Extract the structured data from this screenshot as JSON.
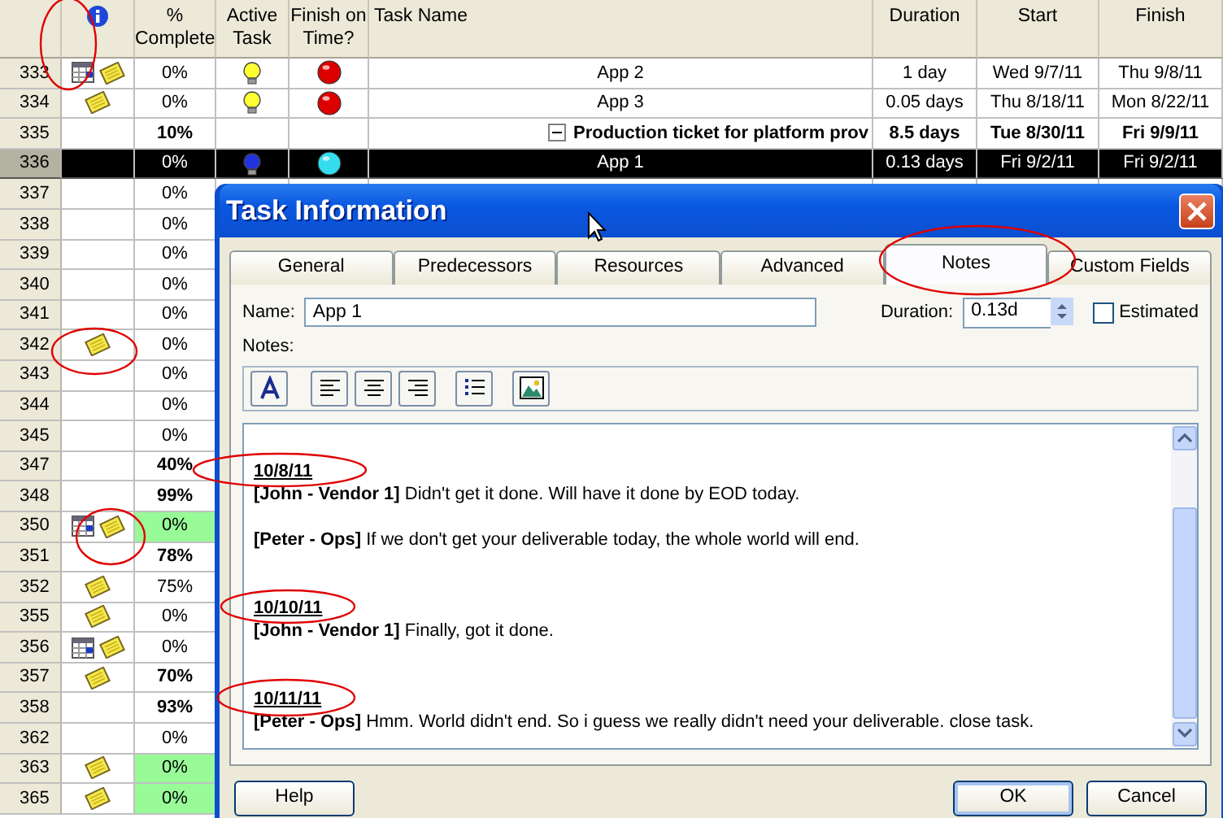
{
  "columns": [
    {
      "kind": "rowid"
    },
    {
      "kind": "indicators"
    },
    {
      "kind": "percent",
      "label": "% Complete"
    },
    {
      "kind": "active",
      "label": "Active Task"
    },
    {
      "kind": "ontime",
      "label": "Finish on Time?"
    },
    {
      "kind": "name",
      "label": "Task Name"
    },
    {
      "kind": "duration",
      "label": "Duration"
    },
    {
      "kind": "start",
      "label": "Start"
    },
    {
      "kind": "finish",
      "label": "Finish"
    }
  ],
  "rows": [
    {
      "id": "333",
      "indicators": [
        {
          "kind": "calendar"
        },
        {
          "kind": "note"
        }
      ],
      "percent": "0%",
      "summary": false,
      "highlight": false,
      "selected": false,
      "active": {
        "color": "#ffff33"
      },
      "on_time": {
        "color": "#dd0000"
      },
      "name": "App 2",
      "duration": "1 day",
      "start": "Wed 9/7/11",
      "finish": "Thu 9/8/11"
    },
    {
      "id": "334",
      "indicators": [
        {
          "kind": "note"
        }
      ],
      "percent": "0%",
      "summary": false,
      "highlight": false,
      "selected": false,
      "active": {
        "color": "#ffff33"
      },
      "on_time": {
        "color": "#dd0000"
      },
      "name": "App 3",
      "duration": "0.05 days",
      "start": "Thu 8/18/11",
      "finish": "Mon 8/22/11"
    },
    {
      "id": "335",
      "indicators": [],
      "percent": "10%",
      "summary": true,
      "expanded": true,
      "highlight": false,
      "selected": false,
      "name": "Production ticket for platform prov",
      "duration": "8.5 days",
      "start": "Tue 8/30/11",
      "finish": "Fri 9/9/11"
    },
    {
      "id": "336",
      "indicators": [],
      "percent": "0%",
      "summary": false,
      "highlight": false,
      "selected": true,
      "active": {
        "color": "#2233dd"
      },
      "on_time": {
        "color": "#33ddee"
      },
      "name": "App 1",
      "duration": "0.13 days",
      "start": "Fri 9/2/11",
      "finish": "Fri 9/2/11"
    },
    {
      "id": "337",
      "indicators": [],
      "percent": "0%",
      "summary": false,
      "highlight": false,
      "selected": false
    },
    {
      "id": "338",
      "indicators": [],
      "percent": "0%",
      "summary": false,
      "highlight": false,
      "selected": false
    },
    {
      "id": "339",
      "indicators": [],
      "percent": "0%",
      "summary": false,
      "highlight": false,
      "selected": false
    },
    {
      "id": "340",
      "indicators": [],
      "percent": "0%",
      "summary": false,
      "highlight": false,
      "selected": false
    },
    {
      "id": "341",
      "indicators": [],
      "percent": "0%",
      "summary": false,
      "highlight": false,
      "selected": false
    },
    {
      "id": "342",
      "indicators": [
        {
          "kind": "note"
        }
      ],
      "percent": "0%",
      "summary": false,
      "highlight": false,
      "selected": false
    },
    {
      "id": "343",
      "indicators": [],
      "percent": "0%",
      "summary": false,
      "highlight": false,
      "selected": false
    },
    {
      "id": "344",
      "indicators": [],
      "percent": "0%",
      "summary": false,
      "highlight": false,
      "selected": false
    },
    {
      "id": "345",
      "indicators": [],
      "percent": "0%",
      "summary": false,
      "highlight": false,
      "selected": false
    },
    {
      "id": "347",
      "indicators": [],
      "percent": "40%",
      "summary": true,
      "highlight": false,
      "selected": false
    },
    {
      "id": "348",
      "indicators": [],
      "percent": "99%",
      "summary": true,
      "highlight": false,
      "selected": false
    },
    {
      "id": "350",
      "indicators": [
        {
          "kind": "calendar"
        },
        {
          "kind": "note"
        }
      ],
      "percent": "0%",
      "summary": false,
      "highlight": true,
      "selected": false
    },
    {
      "id": "351",
      "indicators": [],
      "percent": "78%",
      "summary": true,
      "highlight": false,
      "selected": false
    },
    {
      "id": "352",
      "indicators": [
        {
          "kind": "note"
        }
      ],
      "percent": "75%",
      "summary": false,
      "highlight": false,
      "selected": false
    },
    {
      "id": "355",
      "indicators": [
        {
          "kind": "note"
        }
      ],
      "percent": "0%",
      "summary": false,
      "highlight": false,
      "selected": false
    },
    {
      "id": "356",
      "indicators": [
        {
          "kind": "calendar"
        },
        {
          "kind": "note"
        }
      ],
      "percent": "0%",
      "summary": false,
      "highlight": false,
      "selected": false
    },
    {
      "id": "357",
      "indicators": [
        {
          "kind": "note"
        }
      ],
      "percent": "70%",
      "summary": true,
      "highlight": false,
      "selected": false
    },
    {
      "id": "358",
      "indicators": [],
      "percent": "93%",
      "summary": true,
      "highlight": false,
      "selected": false
    },
    {
      "id": "362",
      "indicators": [],
      "percent": "0%",
      "summary": false,
      "highlight": false,
      "selected": false
    },
    {
      "id": "363",
      "indicators": [
        {
          "kind": "note"
        }
      ],
      "percent": "0%",
      "summary": false,
      "highlight": true,
      "selected": false
    },
    {
      "id": "365",
      "indicators": [
        {
          "kind": "note"
        }
      ],
      "percent": "0%",
      "summary": false,
      "highlight": true,
      "selected": false
    }
  ],
  "dialog": {
    "title": "Task Information",
    "tabs": [
      {
        "label": "General",
        "selected": false
      },
      {
        "label": "Predecessors",
        "selected": false
      },
      {
        "label": "Resources",
        "selected": false
      },
      {
        "label": "Advanced",
        "selected": false
      },
      {
        "label": "Notes",
        "selected": true
      },
      {
        "label": "Custom Fields",
        "selected": false
      }
    ],
    "name_label": "Name:",
    "name_value": "App 1",
    "duration_label": "Duration:",
    "duration_value": "0.13d",
    "estimated": {
      "label": "Estimated",
      "checked": false
    },
    "notes_label": "Notes:",
    "toolbar": [
      {
        "kind": "font"
      },
      {
        "kind": "align-left"
      },
      {
        "kind": "align-center"
      },
      {
        "kind": "align-right"
      },
      {
        "kind": "bullets"
      },
      {
        "kind": "picture"
      }
    ],
    "notes": [
      {
        "kind": "date",
        "text": "10/8/11"
      },
      {
        "kind": "entry",
        "text": "**[John - Vendor 1]** Didn't get it done. Will have it done by EOD today."
      },
      {
        "kind": "entry",
        "text": "**[Peter - Ops]** If we don't get your deliverable today, the whole world will end."
      },
      {
        "kind": "date",
        "text": "10/10/11"
      },
      {
        "kind": "entry",
        "text": "**[John - Vendor 1]** Finally, got it done."
      },
      {
        "kind": "date",
        "text": "10/11/11"
      },
      {
        "kind": "entry",
        "text": "**[Peter - Ops]** Hmm. World didn't end. So i guess we really didn't need your deliverable. close task."
      }
    ],
    "buttons": [
      {
        "label": "Help",
        "kind": "left"
      },
      {
        "label": "OK",
        "kind": "default"
      },
      {
        "label": "Cancel",
        "kind": "normal"
      }
    ]
  }
}
